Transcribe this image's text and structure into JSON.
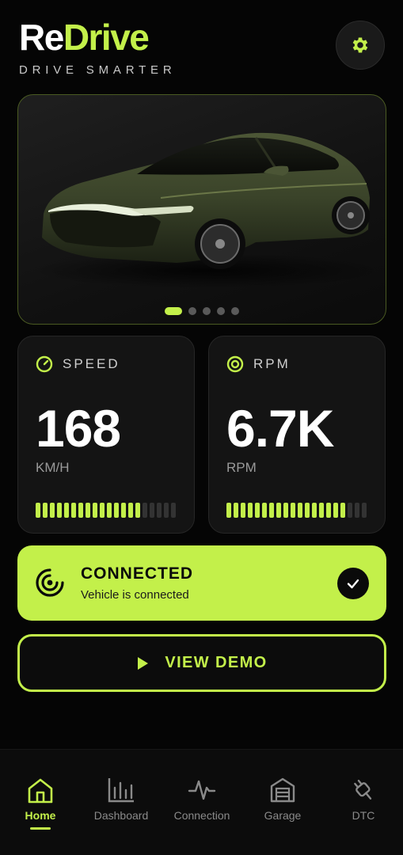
{
  "app": {
    "logo_part1": "Re",
    "logo_part2": "Drive",
    "tagline": "DRIVE SMARTER"
  },
  "colors": {
    "accent": "#c3f04a",
    "background": "#050505",
    "card": "#141414"
  },
  "hero": {
    "slide_count": 5,
    "active_slide": 1
  },
  "speed": {
    "label": "SPEED",
    "value": "168",
    "unit": "KM/H",
    "segments_total": 20,
    "segments_on": 15,
    "icon": "gauge-icon"
  },
  "rpm": {
    "label": "RPM",
    "value": "6.7K",
    "unit": "RPM",
    "segments_total": 20,
    "segments_on": 17,
    "icon": "target-icon"
  },
  "connection": {
    "title": "CONNECTED",
    "subtitle": "Vehicle is connected",
    "icon": "signal-icon",
    "status_icon": "check-icon"
  },
  "demo": {
    "label": "VIEW DEMO",
    "icon": "play-icon"
  },
  "nav": {
    "items": [
      {
        "label": "Home",
        "icon": "home-icon",
        "active": true
      },
      {
        "label": "Dashboard",
        "icon": "bar-chart-icon",
        "active": false
      },
      {
        "label": "Connection",
        "icon": "pulse-icon",
        "active": false
      },
      {
        "label": "Garage",
        "icon": "garage-icon",
        "active": false
      },
      {
        "label": "DTC",
        "icon": "plug-icon",
        "active": false
      }
    ]
  }
}
